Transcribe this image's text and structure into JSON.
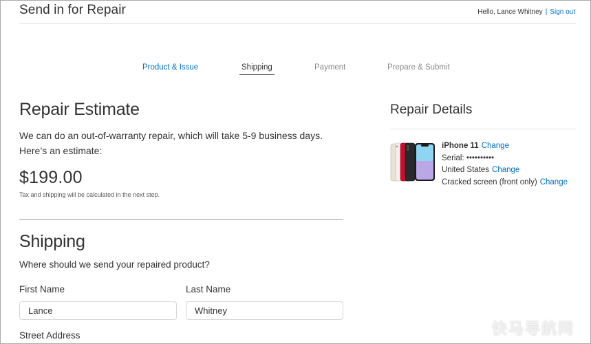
{
  "header": {
    "title": "Send in for Repair",
    "greeting": "Hello, Lance Whitney",
    "separator": "|",
    "sign_out": "Sign out"
  },
  "steps": [
    {
      "label": "Product & Issue",
      "state": "done"
    },
    {
      "label": "Shipping",
      "state": "current"
    },
    {
      "label": "Payment",
      "state": "upcoming"
    },
    {
      "label": "Prepare & Submit",
      "state": "upcoming"
    }
  ],
  "estimate": {
    "title": "Repair Estimate",
    "description": "We can do an out-of-warranty repair, which will take 5-9 business days. Here’s an estimate:",
    "price": "$199.00",
    "note": "Tax and shipping will be calculated in the next step."
  },
  "shipping": {
    "title": "Shipping",
    "question": "Where should we send your repaired product?",
    "first_name_label": "First Name",
    "first_name_value": "Lance",
    "last_name_label": "Last Name",
    "last_name_value": "Whitney",
    "street_label": "Street Address"
  },
  "details": {
    "title": "Repair Details",
    "model": "iPhone 11",
    "serial_label": "Serial:",
    "serial_value": "••••••••••",
    "country": "United States",
    "issue": "Cracked screen (front only)",
    "change": "Change"
  },
  "watermark": "快马导航网",
  "colors": {
    "link": "#0070c9",
    "text": "#333333",
    "muted": "#8a8a8a"
  }
}
